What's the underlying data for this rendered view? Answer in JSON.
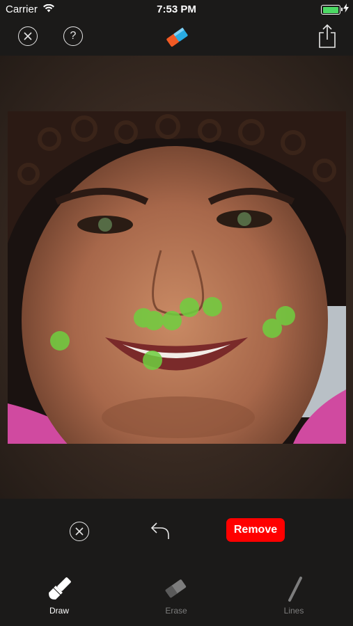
{
  "status_bar": {
    "carrier": "Carrier",
    "time": "7:53 PM",
    "battery_level": 1.0,
    "battery_color": "#4cd964"
  },
  "toolbar": {
    "close_icon": "x-circle-icon",
    "help_label": "?",
    "logo_icon": "eraser-logo-icon",
    "share_icon": "share-icon"
  },
  "canvas": {
    "image_description_icon": "photo",
    "marker_color": "#6fcf3f"
  },
  "actions": {
    "cancel_icon": "x-circle-icon",
    "undo_icon": "undo-icon",
    "remove_label": "Remove"
  },
  "tools": [
    {
      "label": "Draw",
      "icon": "brush-icon",
      "selected": true
    },
    {
      "label": "Erase",
      "icon": "eraser-icon",
      "selected": false
    },
    {
      "label": "Lines",
      "icon": "line-icon",
      "selected": false
    }
  ],
  "colors": {
    "accent_remove": "#ff0000",
    "background": "#1b1a19",
    "inactive_tool": "#7d7d7d"
  }
}
